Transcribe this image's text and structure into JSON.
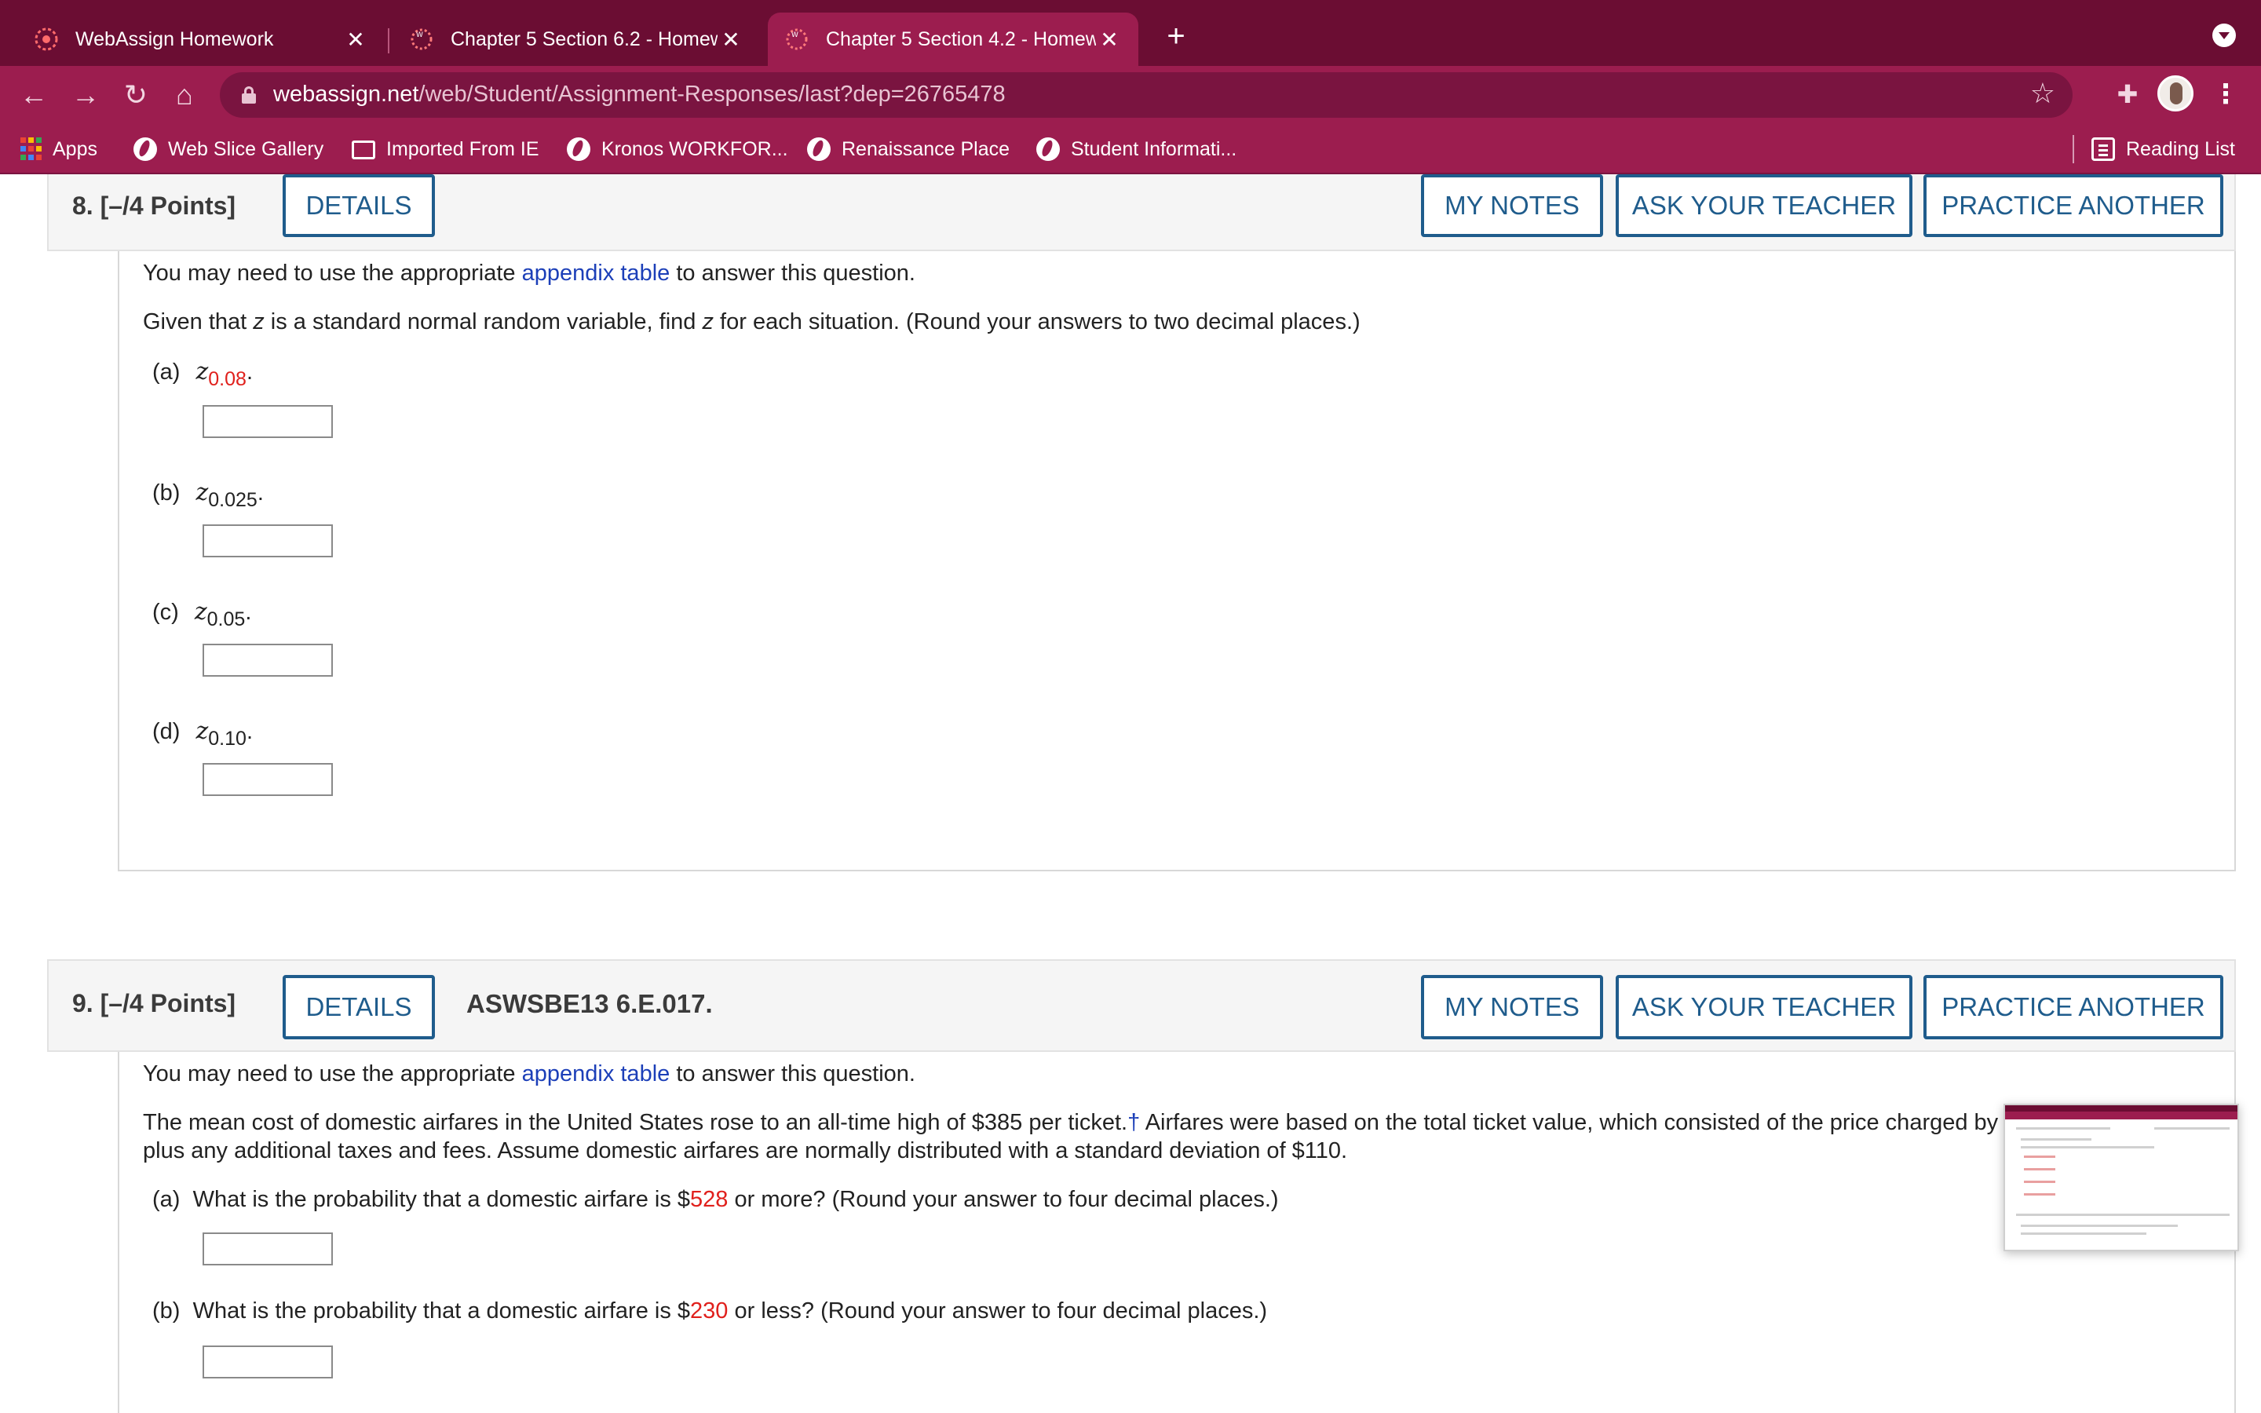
{
  "browser": {
    "tabs": [
      {
        "title": "WebAssign Homework",
        "active": false
      },
      {
        "title": "Chapter 5 Section 6.2 - Homew",
        "active": false
      },
      {
        "title": "Chapter 5 Section 4.2 - Homew",
        "active": true
      }
    ],
    "new_tab_label": "+",
    "close_glyph": "✕",
    "url_domain": "webassign.net",
    "url_path": "/web/Student/Assignment-Responses/last?dep=26765478",
    "bookmarks": [
      {
        "label": "Apps",
        "icon": "apps-grid-icon"
      },
      {
        "label": "Web Slice Gallery",
        "icon": "globe-icon"
      },
      {
        "label": "Imported From IE",
        "icon": "folder-icon"
      },
      {
        "label": "Kronos WORKFOR...",
        "icon": "globe-icon"
      },
      {
        "label": "Renaissance Place",
        "icon": "globe-icon"
      },
      {
        "label": "Student Informati...",
        "icon": "globe-icon"
      }
    ],
    "reading_list": "Reading List",
    "colors": {
      "tabbar": "#6b0d33",
      "toolbar": "#9c1d4f"
    }
  },
  "questions": [
    {
      "number": "8.",
      "points": "[–/4 Points]",
      "code": "",
      "buttons": {
        "details": "DETAILS",
        "my_notes": "MY NOTES",
        "ask_teacher": "ASK YOUR TEACHER",
        "practice": "PRACTICE ANOTHER"
      },
      "appendix_pre": "You may need to use the appropriate ",
      "appendix_link": "appendix table",
      "appendix_post": " to answer this question.",
      "prompt_parts": [
        "Given that ",
        "z",
        " is a standard normal random variable, find ",
        "z",
        " for each situation. (Round your answers to two decimal places.)"
      ],
      "parts": [
        {
          "label": "(a)",
          "var": "z",
          "sub": "0.08",
          "sub_red": true,
          "answer": ""
        },
        {
          "label": "(b)",
          "var": "z",
          "sub": "0.025",
          "sub_red": false,
          "answer": ""
        },
        {
          "label": "(c)",
          "var": "z",
          "sub": "0.05",
          "sub_red": false,
          "answer": ""
        },
        {
          "label": "(d)",
          "var": "z",
          "sub": "0.10",
          "sub_red": false,
          "answer": ""
        }
      ]
    },
    {
      "number": "9.",
      "points": "[–/4 Points]",
      "code": "ASWSBE13 6.E.017.",
      "buttons": {
        "details": "DETAILS",
        "my_notes": "MY NOTES",
        "ask_teacher": "ASK YOUR TEACHER",
        "practice": "PRACTICE ANOTHER"
      },
      "appendix_pre": "You may need to use the appropriate ",
      "appendix_link": "appendix table",
      "appendix_post": " to answer this question.",
      "prompt_line1_a": "The mean cost of domestic airfares in the United States rose to an all-time high of $385 per ticket.",
      "prompt_dagger": "†",
      "prompt_line1_b": " Airfares were based on the total ticket value, which consisted of the price charged by the airlines",
      "prompt_line2": "plus any additional taxes and fees. Assume domestic airfares are normally distributed with a standard deviation of $110.",
      "parts": [
        {
          "label": "(a)",
          "pre": "What is the probability that a domestic airfare is $",
          "value": "528",
          "post": " or more? (Round your answer to four decimal places.)",
          "answer": ""
        },
        {
          "label": "(b)",
          "pre": "What is the probability that a domestic airfare is $",
          "value": "230",
          "post": " or less? (Round your answer to four decimal places.)",
          "answer": ""
        }
      ]
    }
  ]
}
